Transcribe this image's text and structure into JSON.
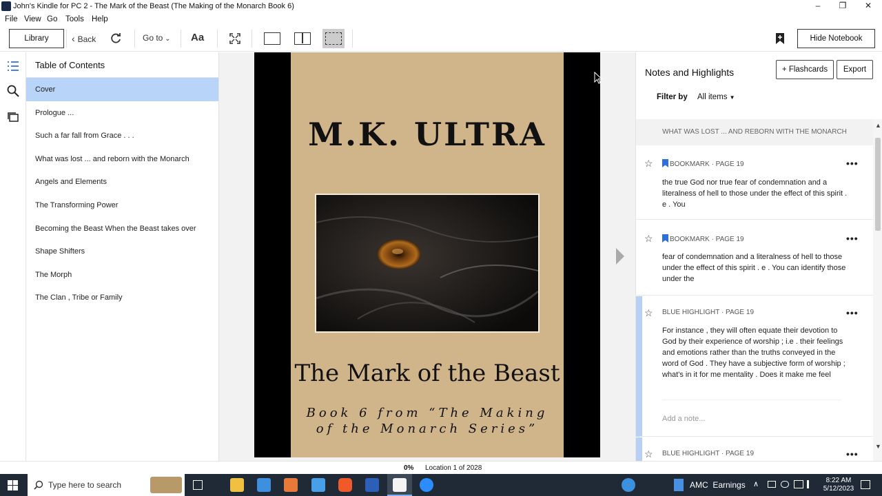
{
  "window": {
    "title": "John's Kindle for PC 2 - The Mark of the Beast (The Making of the Monarch Book 6)",
    "minimize": "–",
    "restore": "❐",
    "close": "✕"
  },
  "menu": [
    "File",
    "View",
    "Go",
    "Tools",
    "Help"
  ],
  "toolbar": {
    "library": "Library",
    "back": "Back",
    "goto": "Go to",
    "font": "Aa",
    "hide_notebook": "Hide Notebook"
  },
  "toc": {
    "heading": "Table of Contents",
    "items": [
      "Cover",
      "Prologue ...",
      "Such a far fall from Grace . . .",
      "What was lost ... and reborn with the Monarch",
      "Angels and Elements",
      "The Transforming Power",
      "Becoming the Beast When the Beast takes over",
      "Shape Shifters",
      "The Morph",
      "The Clan , Tribe or Family"
    ]
  },
  "cover": {
    "title": "M.K. ULTRA",
    "subtitle": "The Mark of the Beast",
    "series_line1": "Book 6 from “The Making",
    "series_line2": "of the Monarch Series”"
  },
  "notebook": {
    "title": "Notes and Highlights",
    "flashcards": "+ Flashcards",
    "export": "Export",
    "filter_label": "Filter by",
    "filter_value": "All items",
    "section": "WHAT WAS LOST ... AND REBORN WITH THE MONARCH",
    "cards": [
      {
        "type": "BOOKMARK · PAGE 19",
        "text": "the true God nor true fear of condemnation and a literalness of hell to those under the effect of this spirit . e . You"
      },
      {
        "type": "BOOKMARK · PAGE 19",
        "text": "fear of condemnation and a literalness of hell to those under the effect of this spirit . e . You can identify those under the"
      },
      {
        "type": "BLUE HIGHLIGHT · PAGE 19",
        "text": "For instance , they will often equate their devotion to God by their experience of worship ; i.e . their feelings and emotions rather than the truths conveyed in the word of God . They have a subjective form of worship ; what's in it for me mentality . Does it make me feel",
        "note_placeholder": "Add a note..."
      },
      {
        "type": "BLUE HIGHLIGHT · PAGE 19",
        "text": ""
      }
    ]
  },
  "status": {
    "percent": "0%",
    "location": "Location 1 of 2028"
  },
  "taskbar": {
    "search_placeholder": "Type here to search",
    "widget": "AMC  Earnings",
    "time": "8:22 AM",
    "date": "5/12/2023"
  },
  "colors": {
    "toc_active": "#b8d4f8",
    "bookmark": "#2f6fdc",
    "highlight_bar": "#b9d0f6",
    "cover_bg": "#d0b48a",
    "taskbar": "#1f2a36"
  }
}
